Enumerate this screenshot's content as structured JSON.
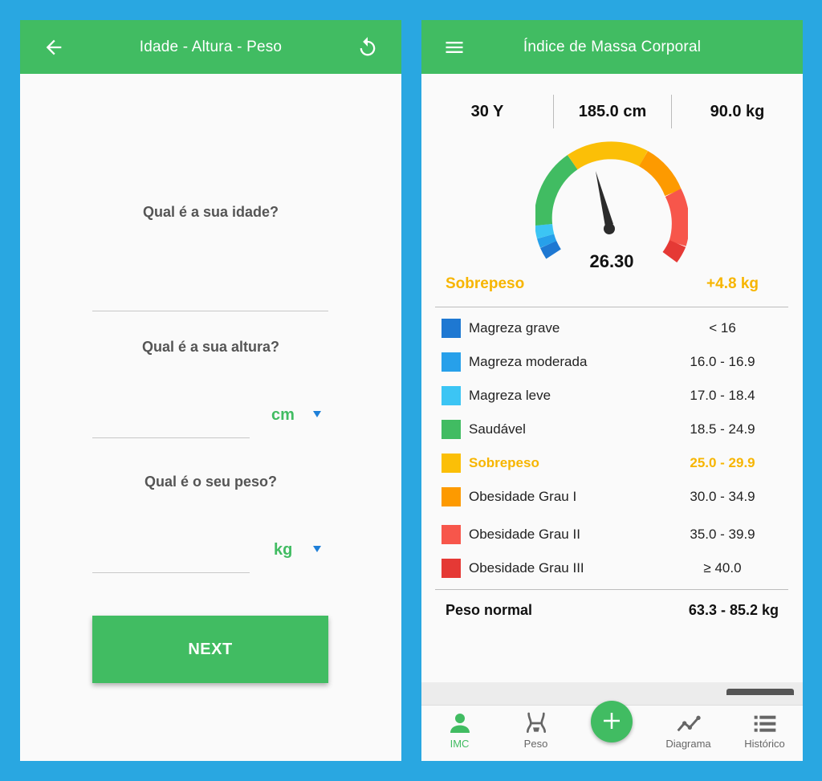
{
  "left": {
    "header": {
      "title": "Idade - Altura - Peso",
      "back_icon": "arrow-left-icon",
      "reset_icon": "refresh-icon"
    },
    "questions": {
      "age": "Qual é a sua idade?",
      "height": "Qual é a sua altura?",
      "weight": "Qual é o seu peso?"
    },
    "units": {
      "height": "cm",
      "weight": "kg"
    },
    "next_label": "NEXT"
  },
  "right": {
    "header": {
      "title": "Índice de Massa Corporal",
      "menu_icon": "hamburger-menu-icon"
    },
    "stats": {
      "age": "30 Y",
      "height": "185.0 cm",
      "weight": "90.0 kg"
    },
    "bmi": "26.30",
    "category": "Sobrepeso",
    "difference": "+4.8 kg",
    "categories": [
      {
        "label": "Magreza grave",
        "range": "< 16",
        "color": "#1e78d2"
      },
      {
        "label": "Magreza moderada",
        "range": "16.0 - 16.9",
        "color": "#27a0ea"
      },
      {
        "label": "Magreza leve",
        "range": "17.0 - 18.4",
        "color": "#3cc5f4"
      },
      {
        "label": "Saudável",
        "range": "18.5 - 24.9",
        "color": "#41bc62"
      },
      {
        "label": "Sobrepeso",
        "range": "25.0 - 29.9",
        "color": "#fbbf07"
      },
      {
        "label": "Obesidade Grau I",
        "range": "30.0 - 34.9",
        "color": "#fd9a00"
      },
      {
        "label": "Obesidade Grau II",
        "range": "35.0 - 39.9",
        "color": "#f7564b"
      },
      {
        "label": "Obesidade Grau III",
        "range": "≥ 40.0",
        "color": "#e53935"
      }
    ],
    "normal_weight": {
      "label": "Peso normal",
      "value": "63.3 - 85.2 kg"
    },
    "nav": [
      {
        "label": "IMC",
        "icon": "person-icon"
      },
      {
        "label": "Peso",
        "icon": "body-scale-icon"
      },
      {
        "label": "Diagrama",
        "icon": "line-chart-icon"
      },
      {
        "label": "Histórico",
        "icon": "list-icon"
      }
    ],
    "fab_icon": "plus-icon"
  },
  "colors": {
    "primary": "#41bc62",
    "accent": "#f7b500",
    "background": "#29a7e1",
    "caret": "#1e7fd8"
  }
}
